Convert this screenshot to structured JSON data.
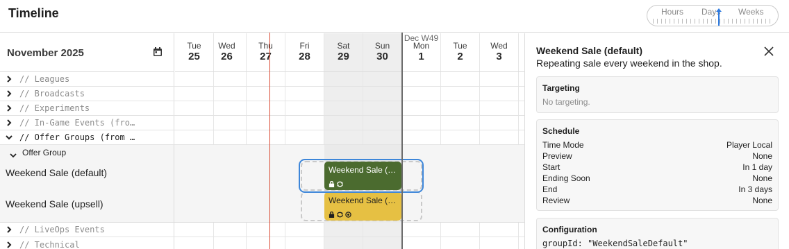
{
  "app": {
    "title": "Timeline",
    "zoom": {
      "options": [
        "Hours",
        "Days",
        "Weeks"
      ],
      "selected": "Days"
    }
  },
  "calendar": {
    "month": "November 2025",
    "week_label": "Dec W49",
    "days": [
      {
        "name": "Tue",
        "num": "25",
        "weekend": false
      },
      {
        "name": "Wed",
        "num": "26",
        "weekend": false
      },
      {
        "name": "Thu",
        "num": "27",
        "weekend": false
      },
      {
        "name": "Fri",
        "num": "28",
        "weekend": false
      },
      {
        "name": "Sat",
        "num": "29",
        "weekend": true
      },
      {
        "name": "Sun",
        "num": "30",
        "weekend": true
      },
      {
        "name": "Mon",
        "num": "1",
        "weekend": false
      },
      {
        "name": "Tue",
        "num": "2",
        "weekend": false
      },
      {
        "name": "Wed",
        "num": "3",
        "weekend": false
      }
    ]
  },
  "groups": {
    "leagues": "// Leagues",
    "broadcasts": "// Broadcasts",
    "experiments": "// Experiments",
    "ingame": "// In-Game Events (fro…",
    "offer_groups": "// Offer Groups (from …",
    "offer_group": "Offer Group",
    "liveops": "// LiveOps Events",
    "technical": "// Technical"
  },
  "items": {
    "default_label": "Weekend Sale (default)",
    "upsell_label": "Weekend Sale (upsell)",
    "default_block": "Weekend Sale (…",
    "upsell_block": "Weekend Sale (…",
    "default_color": "#4b6b2f",
    "upsell_color": "#e6c043"
  },
  "details": {
    "title": "Weekend Sale (default)",
    "subtitle": "Repeating sale every weekend in the shop.",
    "targeting": {
      "title": "Targeting",
      "empty": "No targeting."
    },
    "schedule": {
      "title": "Schedule",
      "rows": [
        {
          "label": "Time Mode",
          "value": "Player Local"
        },
        {
          "label": "Preview",
          "value": "None"
        },
        {
          "label": "Start",
          "value": "In 1 day"
        },
        {
          "label": "Ending Soon",
          "value": "None"
        },
        {
          "label": "End",
          "value": "In 3 days"
        },
        {
          "label": "Review",
          "value": "None"
        }
      ]
    },
    "configuration": {
      "title": "Configuration",
      "line": "groupId: \"WeekendSaleDefault\""
    }
  },
  "colors": {
    "now_line": "#d9472f",
    "selection": "#3d86d9",
    "accent": "#2f7be0"
  }
}
